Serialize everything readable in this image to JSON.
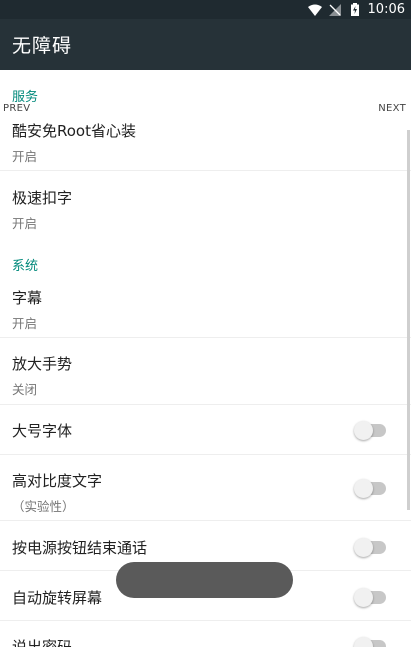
{
  "status_bar": {
    "time": "10:06",
    "icons": [
      "wifi-icon",
      "signal-off-icon",
      "battery-charging-icon"
    ]
  },
  "app_bar": {
    "title": "无障碍"
  },
  "pager": {
    "prev": "PREV",
    "next": "NEXT"
  },
  "sections": {
    "services": "服务",
    "system": "系统"
  },
  "items": {
    "kuan": {
      "title": "酷安免Root省心装",
      "summary": "开启"
    },
    "jisu": {
      "title": "极速扣字",
      "summary": "开启"
    },
    "captions": {
      "title": "字幕",
      "summary": "开启"
    },
    "magnify": {
      "title": "放大手势",
      "summary": "关闭"
    },
    "large_text": {
      "title": "大号字体",
      "toggle": false
    },
    "high_contrast": {
      "title": "高对比度文字",
      "summary": "（实验性）",
      "toggle": false
    },
    "power_end_call": {
      "title": "按电源按钮结束通话",
      "toggle": false
    },
    "auto_rotate": {
      "title": "自动旋转屏幕",
      "toggle": false
    },
    "speak_password": {
      "title": "说出密码",
      "toggle": false
    }
  },
  "colors": {
    "app_bar": "#263238",
    "status_bar": "#1f2a30",
    "accent": "#00897b"
  }
}
